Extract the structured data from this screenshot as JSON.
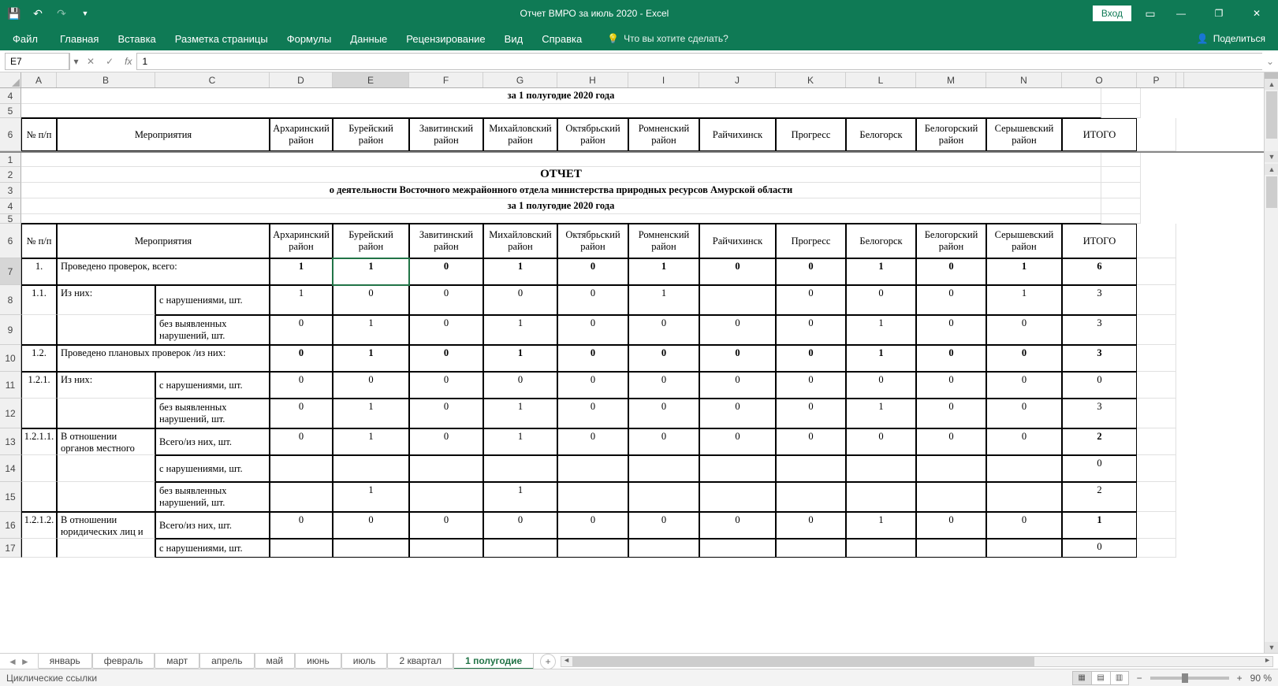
{
  "app": {
    "title": "Отчет ВМРО за июль 2020  -  Excel",
    "signin": "Вход",
    "share": "Поделиться"
  },
  "ribbon": {
    "file": "Файл",
    "tabs": [
      "Главная",
      "Вставка",
      "Разметка страницы",
      "Формулы",
      "Данные",
      "Рецензирование",
      "Вид",
      "Справка"
    ],
    "tellme_placeholder": "Что вы хотите сделать?"
  },
  "namebox": "E7",
  "formula": "1",
  "columns": [
    "A",
    "B",
    "C",
    "D",
    "E",
    "F",
    "G",
    "H",
    "I",
    "J",
    "K",
    "L",
    "M",
    "N",
    "O",
    "P",
    ""
  ],
  "selected_col": "E",
  "selected_row": "7",
  "frozen": {
    "title_row4": "за  1 полугодие 2020 года",
    "hdr_num": "№ п/п",
    "hdr_event": "Мероприятия",
    "districts": [
      "Архаринский район",
      "Бурейский район",
      "Завитинский район",
      "Михайловский район",
      "Октябрьский район",
      "Ромненский район",
      "Райчихинск",
      "Прогресс",
      "Белогорск",
      "Белогорский район",
      "Серышевский район",
      "ИТОГО"
    ]
  },
  "body": {
    "r1_empty": "",
    "r2_title": "ОТЧЕТ",
    "r3_sub": "о деятельности Восточного межрайонного отдела министерства природных ресурсов Амурской области",
    "r4_period": "за  1 полугодие 2020 года",
    "hdr_num": "№ п/п",
    "hdr_event": "Мероприятия",
    "districts": [
      "Архаринский район",
      "Бурейский район",
      "Завитинский район",
      "Михайловский район",
      "Октябрьский район",
      "Ромненский район",
      "Райчихинск",
      "Прогресс",
      "Белогорск",
      "Белогорский район",
      "Серышевский район",
      "ИТОГО"
    ]
  },
  "rows": {
    "r7": {
      "n": "1.",
      "t": "Проведено проверок, всего:",
      "v": [
        "1",
        "1",
        "0",
        "1",
        "0",
        "1",
        "0",
        "0",
        "1",
        "0",
        "1",
        "6"
      ]
    },
    "r8": {
      "n": "1.1.",
      "t": "Из них:",
      "t2": "с нарушениями, шт.",
      "v": [
        "1",
        "0",
        "0",
        "0",
        "0",
        "1",
        "",
        "0",
        "0",
        "0",
        "1",
        "3"
      ]
    },
    "r9": {
      "t2": "без выявленных нарушений, шт.",
      "v": [
        "0",
        "1",
        "0",
        "1",
        "0",
        "0",
        "0",
        "0",
        "1",
        "0",
        "0",
        "3"
      ]
    },
    "r10": {
      "n": "1.2.",
      "t": "Проведено плановых проверок /из них:",
      "v": [
        "0",
        "1",
        "0",
        "1",
        "0",
        "0",
        "0",
        "0",
        "1",
        "0",
        "0",
        "3"
      ]
    },
    "r11": {
      "n": "1.2.1.",
      "t": "Из них:",
      "t2": "с нарушениями, шт.",
      "v": [
        "0",
        "0",
        "0",
        "0",
        "0",
        "0",
        "0",
        "0",
        "0",
        "0",
        "0",
        "0"
      ]
    },
    "r12": {
      "t2": "без выявленных нарушений, шт.",
      "v": [
        "0",
        "1",
        "0",
        "1",
        "0",
        "0",
        "0",
        "0",
        "1",
        "0",
        "0",
        "3"
      ]
    },
    "r13": {
      "n": "1.2.1.1.",
      "t": "В отношении органов местного самоуправления",
      "t2": "Всего/из них, шт.",
      "v": [
        "0",
        "1",
        "0",
        "1",
        "0",
        "0",
        "0",
        "0",
        "0",
        "0",
        "0",
        "2"
      ]
    },
    "r14": {
      "t2": "с нарушениями, шт.",
      "v": [
        "",
        "",
        "",
        "",
        "",
        "",
        "",
        "",
        "",
        "",
        "",
        "0"
      ]
    },
    "r15": {
      "t2": "без выявленных нарушений, шт.",
      "v": [
        "",
        "1",
        "",
        "1",
        "",
        "",
        "",
        "",
        "",
        "",
        "",
        "2"
      ]
    },
    "r16": {
      "n": "1.2.1.2.",
      "t": "В отношении юридических лиц и индивидуальных предпринимателей",
      "t2": "Всего/из них, шт.",
      "v": [
        "0",
        "0",
        "0",
        "0",
        "0",
        "0",
        "0",
        "0",
        "1",
        "0",
        "0",
        "1"
      ]
    },
    "r17": {
      "t2": "с нарушениями, шт.",
      "v": [
        "",
        "",
        "",
        "",
        "",
        "",
        "",
        "",
        "",
        "",
        "",
        "0"
      ]
    }
  },
  "sheets": {
    "tabs": [
      "январь",
      "февраль",
      "март",
      "апрель",
      "май",
      "июнь",
      "июль",
      "2 квартал",
      "1 полугодие"
    ],
    "active": "1 полугодие"
  },
  "status": {
    "left": "Циклические ссылки",
    "zoom": "90 %"
  }
}
